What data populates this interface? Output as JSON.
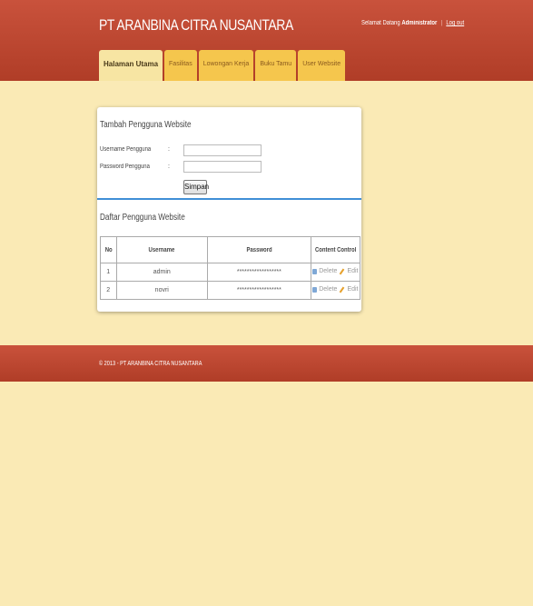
{
  "header": {
    "site_title": "PT ARANBINA CITRA NUSANTARA",
    "welcome_prefix": "Selamat Datang",
    "user_name": "Administrator",
    "logout_label": "Log out"
  },
  "tabs": [
    {
      "label": "Halaman Utama",
      "active": true
    },
    {
      "label": "Fasilitas",
      "active": false
    },
    {
      "label": "Lowongan Kerja",
      "active": false
    },
    {
      "label": "Buku Tamu",
      "active": false
    },
    {
      "label": "User Website",
      "active": false
    }
  ],
  "form": {
    "title": "Tambah Pengguna Website",
    "username_label": "Username Pengguna",
    "password_label": "Password Pengguna",
    "colon": ":",
    "username_value": "",
    "password_value": "",
    "submit_label": "Simpan"
  },
  "list": {
    "title": "Daftar Pengguna Website",
    "columns": [
      "No",
      "Username",
      "Password",
      "Content Control"
    ],
    "rows": [
      {
        "no": "1",
        "username": "admin",
        "password": "******************",
        "delete_label": "Delete",
        "edit_label": "Edit"
      },
      {
        "no": "2",
        "username": "novri",
        "password": "******************",
        "delete_label": "Delete",
        "edit_label": "Edit"
      }
    ]
  },
  "footer": {
    "copyright": "© 2013 - PT ARANBINA CITRA NUSANTARA"
  },
  "colors": {
    "header_bg": "#b94530",
    "page_bg": "#faeab5",
    "tab_bg": "#f5c64d",
    "tab_active_bg": "#f7e5a3",
    "divider": "#3f8fd6"
  },
  "icons": {
    "delete": "trash-icon",
    "edit": "pencil-icon"
  }
}
